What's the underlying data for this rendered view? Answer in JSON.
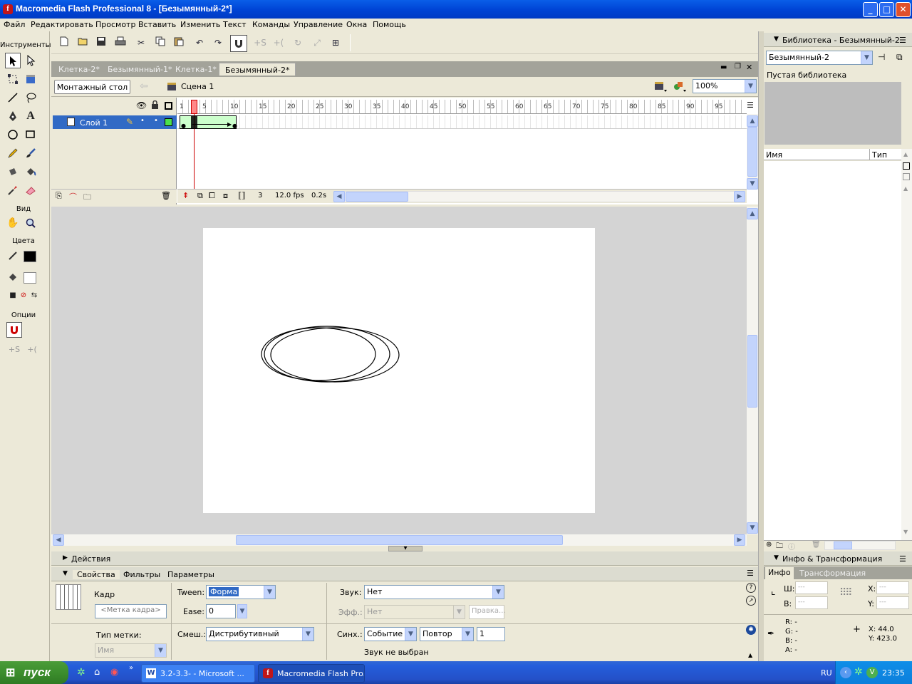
{
  "window": {
    "title": "Macromedia Flash Professional 8 - [Безымянный-2*]",
    "controls": {
      "minimize": "_",
      "maximize": "□",
      "close": "✕"
    }
  },
  "menu": [
    "Файл",
    "Редактировать",
    "Просмотр",
    "Вставить",
    "Изменить",
    "Текст",
    "Команды",
    "Управление",
    "Окна",
    "Помощь"
  ],
  "toolbar": {
    "icons": [
      "new-file-icon",
      "open-folder-icon",
      "save-icon",
      "print-icon",
      "cut-icon",
      "copy-icon",
      "paste-icon",
      "undo-icon",
      "redo-icon",
      "snap-magnet-icon",
      "smooth-icon",
      "straighten-icon",
      "rotate-icon",
      "scale-icon",
      "align-icon"
    ]
  },
  "tools": {
    "title": "Инструменты",
    "view_label": "Вид",
    "colors_label": "Цвета",
    "options_label": "Опции"
  },
  "doc_tabs": [
    "Клетка-2*",
    "Безымянный-1*",
    "Клетка-1*",
    "Безымянный-2*"
  ],
  "edit_bar": {
    "timeline_button": "Монтажный стол",
    "scene": "Сцена 1",
    "zoom": "100%"
  },
  "timeline": {
    "layer_name": "Слой 1",
    "ruler": [
      "1",
      "5",
      "10",
      "15",
      "20",
      "25",
      "30",
      "35",
      "40",
      "45",
      "50",
      "55",
      "60",
      "65",
      "70",
      "75",
      "80",
      "85",
      "90",
      "95"
    ],
    "current_frame": "3",
    "fps": "12.0 fps",
    "time": "0.2s",
    "playhead_frame": 3
  },
  "library": {
    "title": "Библиотека - Безымянный-2",
    "doc_select": "Безымянный-2",
    "empty_text": "Пустая библиотека",
    "col_name": "Имя",
    "col_type": "Тип"
  },
  "info": {
    "title": "Инфо & Трансформация",
    "tab_info": "Инфо",
    "tab_transform": "Трансформация",
    "w_label": "Ш:",
    "h_label": "В:",
    "x_label": "X:",
    "y_label": "Y:",
    "w_val": "---",
    "h_val": "---",
    "x_val": "---",
    "y_val": "---",
    "r": "R: -",
    "g": "G: -",
    "b": "B: -",
    "a": "A: -",
    "cursor_x": "X:  44.0",
    "cursor_y": "Y:  423.0"
  },
  "actions_panel": {
    "title": "Действия"
  },
  "properties": {
    "tabs": [
      "Свойства",
      "Фильтры",
      "Параметры"
    ],
    "kind": "Кадр",
    "frame_label_placeholder": "<Метка кадра>",
    "label_type": "Тип метки:",
    "label_type_value": "Имя",
    "tween_label": "Tween:",
    "tween_value": "Форма",
    "ease_label": "Ease:",
    "ease_value": "0",
    "blend_label": "Смеш.:",
    "blend_value": "Дистрибутивный",
    "sound_label": "Звук:",
    "sound_value": "Нет",
    "effect_label": "Эфф.:",
    "effect_value": "Нет",
    "edit_button": "Правка...",
    "sync_label": "Синх.:",
    "sync_value": "Событие",
    "repeat_value": "Повтор",
    "repeat_count": "1",
    "sound_status": "Звук не выбран"
  },
  "taskbar": {
    "start": "пуск",
    "tasks": [
      "3.2-3.3- - Microsoft ...",
      "Macromedia Flash Pro..."
    ],
    "lang": "RU",
    "clock": "23:35"
  },
  "colors": {
    "accent": "#316ac5",
    "taskbar": "#245edb",
    "start": "#3c8e2d",
    "playhead": "#ff6666",
    "tween": "#ccffcc"
  }
}
